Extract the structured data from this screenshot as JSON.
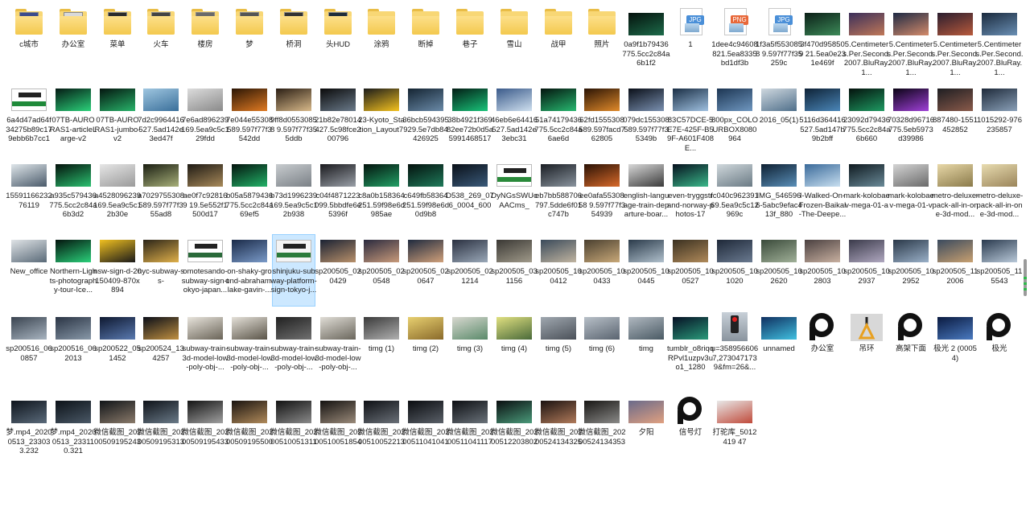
{
  "items": [
    {
      "label": "c城市",
      "kind": "folder",
      "doc": "#3c4b8c"
    },
    {
      "label": "办公室",
      "kind": "folder",
      "doc": "#d9d9d9"
    },
    {
      "label": "菜单",
      "kind": "folder",
      "doc": "#2b2b2b"
    },
    {
      "label": "火车",
      "kind": "folder",
      "doc": "#444444"
    },
    {
      "label": "楼房",
      "kind": "folder",
      "doc": "#6a6a6a"
    },
    {
      "label": "梦",
      "kind": "folder",
      "doc": "#555555"
    },
    {
      "label": "桥洞",
      "kind": "folder",
      "doc": "#333333"
    },
    {
      "label": "头HUD",
      "kind": "folder",
      "doc": "#1f2d3a"
    },
    {
      "label": "涂鸦",
      "kind": "folder"
    },
    {
      "label": "断掉",
      "kind": "folder"
    },
    {
      "label": "巷子",
      "kind": "folder"
    },
    {
      "label": "雪山",
      "kind": "folder"
    },
    {
      "label": "战甲",
      "kind": "folder"
    },
    {
      "label": "照片",
      "kind": "folder"
    },
    {
      "label": "0a9f1b79436775.5cc2c84a6b1f2",
      "kind": "image",
      "colors": [
        "#04110c",
        "#1d6b4a"
      ]
    },
    {
      "label": "1",
      "kind": "file",
      "badge": "JPG",
      "badgeColor": "#4a8fd8"
    },
    {
      "label": "1dee4c94608821.5ea8335bd1df3b",
      "kind": "file",
      "badge": "PNG",
      "badgeColor": "#e8683a"
    },
    {
      "label": "1f3a5f5530858 9.597f77f35259c",
      "kind": "file",
      "badge": "JPG",
      "badgeColor": "#4a8fd8"
    },
    {
      "label": "3f470d958509 21.5ea0e231e469f",
      "kind": "image",
      "colors": [
        "#0b1f17",
        "#3c8a58"
      ]
    },
    {
      "label": "5.Centimeters.Per.Second.2007.BluRay.1...",
      "kind": "image",
      "colors": [
        "#3b2f5a",
        "#c07858"
      ]
    },
    {
      "label": "5.Centimeters.Per.Second.2007.BluRay.1...",
      "kind": "image",
      "colors": [
        "#1e2a44",
        "#d48b6a"
      ]
    },
    {
      "label": "5.Centimeters.Per.Second.2007.BluRay.1...",
      "kind": "image",
      "colors": [
        "#2a1d2e",
        "#b85a3c"
      ]
    },
    {
      "label": "5.Centimeters.Per.Second.2007.BluRay.1...",
      "kind": "image",
      "colors": [
        "#1a2a3d",
        "#6a8fb4"
      ]
    },
    {
      "label": "6a4d47ad64f34275b89c179ebb6b7cc1",
      "kind": "sign",
      "colors": [
        "#ffffff",
        "#1f8a3a"
      ]
    },
    {
      "label": "07TB-AURORAS1-articleLarge-v2",
      "kind": "image",
      "colors": [
        "#051a14",
        "#2bd17a"
      ]
    },
    {
      "label": "07TB-AURORAS1-jumbo-v2",
      "kind": "image",
      "colors": [
        "#04150f",
        "#28b36a"
      ]
    },
    {
      "label": "7d2c9964416527.5ad142e3ed47f",
      "kind": "image",
      "colors": [
        "#9fc6e0",
        "#3a6f9a"
      ]
    },
    {
      "label": "7e6ad896239169.5ea9c5c129fdd",
      "kind": "image",
      "colors": [
        "#dcdcdc",
        "#8a8a8a"
      ]
    },
    {
      "label": "7e044e55308589.597f77f3542dd",
      "kind": "image",
      "colors": [
        "#2a1605",
        "#e07a22"
      ]
    },
    {
      "label": "9ff8d05530858 9.597f77f355ddb",
      "kind": "image",
      "colors": [
        "#2a1e14",
        "#d8b98a"
      ]
    },
    {
      "label": "21b82e78014427.5c98fce200796",
      "kind": "image",
      "colors": [
        "#0a0a0a",
        "#6a7a8a"
      ]
    },
    {
      "label": "23-Kyoto_Station_Layout7",
      "kind": "image",
      "colors": [
        "#1a1a1a",
        "#f4c21f"
      ]
    },
    {
      "label": "36bcb594395929.5e7db84426925",
      "kind": "image",
      "colors": [
        "#142432",
        "#6a8aa8"
      ]
    },
    {
      "label": "38b4921f36982ee72b0d5a5991468517",
      "kind": "image",
      "colors": [
        "#031c14",
        "#19c47a"
      ]
    },
    {
      "label": "46eb6e64416527.5ad142e3ebc31",
      "kind": "image",
      "colors": [
        "#3a5a8a",
        "#cfe0ef"
      ]
    },
    {
      "label": "51a74179436775.5cc2c84a6ae6d",
      "kind": "image",
      "colors": [
        "#04140e",
        "#27b870"
      ]
    },
    {
      "label": "62fd1555308589.597facd762805",
      "kind": "image",
      "colors": [
        "#2a1405",
        "#e08a2a"
      ]
    },
    {
      "label": "079dc155308589.597f77f35349b",
      "kind": "image",
      "colors": [
        "#0a0f18",
        "#7a90b0"
      ]
    },
    {
      "label": "83C57DCE-5E7E-425F-B59F-A601F408E...",
      "kind": "image",
      "colors": [
        "#1a2e44",
        "#9fc0e0"
      ]
    },
    {
      "label": "800px_COLOURBOX8080964",
      "kind": "image",
      "colors": [
        "#1c3552",
        "#6f97c0"
      ]
    },
    {
      "label": "2016_05(1)",
      "kind": "image",
      "colors": [
        "#cfd8df",
        "#4f6f8a"
      ]
    },
    {
      "label": "5116d364416527.5ad147b9b2bff",
      "kind": "image",
      "colors": [
        "#0e2236",
        "#4a86b8"
      ]
    },
    {
      "label": "23092d79436775.5cc2c84a6b660",
      "kind": "image",
      "colors": [
        "#04110c",
        "#1e9a62"
      ]
    },
    {
      "label": "70328d96716775.5eb5973d39986",
      "kind": "image",
      "colors": [
        "#0a0314",
        "#a040d8"
      ]
    },
    {
      "label": "887480-1551452852",
      "kind": "image",
      "colors": [
        "#1e1e22",
        "#8a5a4a"
      ]
    },
    {
      "label": "1015292-976235857",
      "kind": "image",
      "colors": [
        "#1e2a3a",
        "#8aa0b8"
      ]
    },
    {
      "label": "1559116623276119",
      "kind": "image",
      "colors": [
        "#dfe6ea",
        "#4a5a6a"
      ]
    },
    {
      "label": "a935c579436775.5cc2c84a6b3d2",
      "kind": "image",
      "colors": [
        "#04120c",
        "#2bc070"
      ]
    },
    {
      "label": "a4528096239169.5ea9c5c12b30e",
      "kind": "image",
      "colors": [
        "#e6e6e6",
        "#9a9a9a"
      ]
    },
    {
      "label": "a7029755308589.597f77f355ad8",
      "kind": "image",
      "colors": [
        "#1a1e12",
        "#a8b07a"
      ]
    },
    {
      "label": "ae0f7c928169 19.5e552f1500d17",
      "kind": "image",
      "colors": [
        "#1e1a14",
        "#a88a5a"
      ]
    },
    {
      "label": "b05a5879436775.5cc2c84a69ef5",
      "kind": "image",
      "colors": [
        "#04140e",
        "#22b268"
      ]
    },
    {
      "label": "b73d1996239169.5ea9c5c12b938",
      "kind": "image",
      "colors": [
        "#c8cccf",
        "#7a8086"
      ]
    },
    {
      "label": "c04f4871223099.5bbdfe6e5396f",
      "kind": "image",
      "colors": [
        "#1a1a1e",
        "#9aa0a8"
      ]
    },
    {
      "label": "c8a0b158364251.59f98e6d985ae",
      "kind": "image",
      "colors": [
        "#04140e",
        "#22a066"
      ]
    },
    {
      "label": "c649fb58364251.59f98e6d0d9b8",
      "kind": "image",
      "colors": [
        "#04120e",
        "#1f7a5a"
      ]
    },
    {
      "label": "D538_269_076_0004_600",
      "kind": "image",
      "colors": [
        "#0a1018",
        "#3a5a7a"
      ]
    },
    {
      "label": "DyNGsSWUcAACms_",
      "kind": "sign",
      "colors": [
        "#ffffff",
        "#2a8a3a"
      ]
    },
    {
      "label": "eb7bb588706797.5dde6f01c747b",
      "kind": "image",
      "colors": [
        "#1a1e24",
        "#8a949e"
      ]
    },
    {
      "label": "ee0afa5530858 9.597f77f354939",
      "kind": "image",
      "colors": [
        "#2a1205",
        "#d86a2a"
      ]
    },
    {
      "label": "english-language-train-departure-boar...",
      "kind": "image",
      "colors": [
        "#d8d8d8",
        "#3a3a3a"
      ]
    },
    {
      "label": "even-tryggstrand-norway-photos-17",
      "kind": "image",
      "colors": [
        "#06101e",
        "#3ab88a"
      ]
    },
    {
      "label": "fc040c962391 69.5ea9c5c12969c",
      "kind": "image",
      "colors": [
        "#d0d8dc",
        "#6a7a84"
      ]
    },
    {
      "label": "IMG_5465966-5abc9efac413f_880",
      "kind": "image",
      "colors": [
        "#0e2032",
        "#5a8fb8"
      ]
    },
    {
      "label": "I-Walked-On-Frozen-Baikal-The-Deepe...",
      "kind": "image",
      "colors": [
        "#3a6a9a",
        "#c8dff0"
      ]
    },
    {
      "label": "mark-kolobaev-mega-01-a",
      "kind": "image",
      "colors": [
        "#0f1a20",
        "#6a8a98"
      ]
    },
    {
      "label": "mark-kolobaev-mega-01-v",
      "kind": "image",
      "colors": [
        "#d4d4d4",
        "#6a6a6a"
      ]
    },
    {
      "label": "metro-deluxe-pack-all-in-one-3d-mod...",
      "kind": "image",
      "colors": [
        "#e8d8a8",
        "#8a7a4a"
      ]
    },
    {
      "label": "metro-deluxe-pack-all-in-one-3d-mod...",
      "kind": "image",
      "colors": [
        "#e8dcb0",
        "#9a845a"
      ]
    },
    {
      "label": "New_office",
      "kind": "image",
      "colors": [
        "#dfe3e6",
        "#5a6a78"
      ]
    },
    {
      "label": "Northern-Lights-photography-tour-Ice...",
      "kind": "image",
      "colors": [
        "#04140e",
        "#2ad07a"
      ]
    },
    {
      "label": "nsw-sign-d-20150409-870x894",
      "kind": "image",
      "colors": [
        "#f0c020",
        "#1a1a1a"
      ]
    },
    {
      "label": "nyc-subway-ss-",
      "kind": "image",
      "colors": [
        "#2a2418",
        "#e0b04a"
      ]
    },
    {
      "label": "omotesando-subway-sign-tokyo-japan...",
      "kind": "sign",
      "colors": [
        "#ffffff",
        "#2a6a3a"
      ]
    },
    {
      "label": "on-shaky-ground-abraham-lake-gavin-...",
      "kind": "image",
      "colors": [
        "#1a2a48",
        "#7a9ac8"
      ]
    },
    {
      "label": "shinjuku-subway-platform-sign-tokyo-j...",
      "kind": "sign",
      "colors": [
        "#f4f4f4",
        "#2a7a3a"
      ],
      "selected": true
    },
    {
      "label": "sp200505_020429",
      "kind": "image",
      "colors": [
        "#1a2233",
        "#b8906a"
      ]
    },
    {
      "label": "sp200505_020548",
      "kind": "image",
      "colors": [
        "#2a2a3e",
        "#c89a7a"
      ]
    },
    {
      "label": "sp200505_020647",
      "kind": "image",
      "colors": [
        "#1e2a3e",
        "#d0a07a"
      ]
    },
    {
      "label": "sp200505_021214",
      "kind": "image",
      "colors": [
        "#2a3040",
        "#9aa8b8"
      ]
    },
    {
      "label": "sp200505_031156",
      "kind": "image",
      "colors": [
        "#3a3834",
        "#a09a8a"
      ]
    },
    {
      "label": "sp200505_100412",
      "kind": "image",
      "colors": [
        "#3a4a5a",
        "#c0b4a0"
      ]
    },
    {
      "label": "sp200505_100433",
      "kind": "image",
      "colors": [
        "#4a4030",
        "#c8a878"
      ]
    },
    {
      "label": "sp200505_100445",
      "kind": "image",
      "colors": [
        "#2a3a4a",
        "#b0c0cc"
      ]
    },
    {
      "label": "sp200505_100527",
      "kind": "image",
      "colors": [
        "#3a3020",
        "#b08a5a"
      ]
    },
    {
      "label": "sp200505_101020",
      "kind": "image",
      "colors": [
        "#1e2838",
        "#6a7a90"
      ]
    },
    {
      "label": "sp200505_102620",
      "kind": "image",
      "colors": [
        "#3a4a3a",
        "#a0b098"
      ]
    },
    {
      "label": "sp200505_102803",
      "kind": "image",
      "colors": [
        "#4a4040",
        "#c8b0a0"
      ]
    },
    {
      "label": "sp200505_102937",
      "kind": "image",
      "colors": [
        "#3a3a4a",
        "#b0a8c0"
      ]
    },
    {
      "label": "sp200505_102952",
      "kind": "image",
      "colors": [
        "#2a3848",
        "#9ab0c8"
      ]
    },
    {
      "label": "sp200505_112006",
      "kind": "image",
      "colors": [
        "#3a4a5e",
        "#c8a070"
      ]
    },
    {
      "label": "sp200505_115543",
      "kind": "image",
      "colors": [
        "#2a3a4e",
        "#b8c8d8"
      ]
    },
    {
      "label": "sp200516_060857",
      "kind": "image",
      "colors": [
        "#3a4450",
        "#a8b4c0"
      ]
    },
    {
      "label": "sp200516_062013",
      "kind": "image",
      "colors": [
        "#2a3444",
        "#8898a8"
      ]
    },
    {
      "label": "sp200522_051452",
      "kind": "image",
      "colors": [
        "#0e1830",
        "#5a7ab0"
      ]
    },
    {
      "label": "sp200524_134257",
      "kind": "image",
      "colors": [
        "#0a0e18",
        "#c09040"
      ]
    },
    {
      "label": "subway-train-3d-model-low-poly-obj-...",
      "kind": "image",
      "colors": [
        "#e8e4dc",
        "#6a6458"
      ]
    },
    {
      "label": "subway-train-3d-model-low-poly-obj-...",
      "kind": "image",
      "colors": [
        "#e4e0d8",
        "#5a5448"
      ]
    },
    {
      "label": "subway-train-3d-model-low-poly-obj-...",
      "kind": "image",
      "colors": [
        "#202020",
        "#707070"
      ]
    },
    {
      "label": "subway-train-3d-model-low-poly-obj-...",
      "kind": "image",
      "colors": [
        "#e0ddd6",
        "#6a665c"
      ]
    },
    {
      "label": "timg (1)",
      "kind": "image",
      "colors": [
        "#3a3a3a",
        "#b0b0b0"
      ]
    },
    {
      "label": "timg (2)",
      "kind": "image",
      "colors": [
        "#e8d070",
        "#8a6a2a"
      ]
    },
    {
      "label": "timg (3)",
      "kind": "image",
      "colors": [
        "#d8d8d0",
        "#5a8a6a"
      ]
    },
    {
      "label": "timg (4)",
      "kind": "image",
      "colors": [
        "#e0e080",
        "#4a6a3a"
      ]
    },
    {
      "label": "timg (5)",
      "kind": "image",
      "colors": [
        "#a0a8b0",
        "#4a5058"
      ]
    },
    {
      "label": "timg (6)",
      "kind": "image",
      "colors": [
        "#b8c0c8",
        "#5a6470"
      ]
    },
    {
      "label": "timg",
      "kind": "image",
      "colors": [
        "#b0b8c0",
        "#4a5a64"
      ]
    },
    {
      "label": "tumblr_o8riqqRPvl1uzpv3uo1_1280",
      "kind": "image",
      "colors": [
        "#061024",
        "#2a9a7a"
      ]
    },
    {
      "label": "u=3589566067,2730471739&fm=26&...",
      "kind": "signal"
    },
    {
      "label": "unnamed",
      "kind": "image",
      "colors": [
        "#103060",
        "#40c0e0"
      ]
    },
    {
      "label": "办公室",
      "kind": "ring"
    },
    {
      "label": "吊环",
      "kind": "handle"
    },
    {
      "label": "高架下面",
      "kind": "ring"
    },
    {
      "label": "极光 2 (00054)",
      "kind": "image",
      "colors": [
        "#0a1a40",
        "#4a7ac0"
      ]
    },
    {
      "label": "极光",
      "kind": "ring"
    },
    {
      "label": "梦.mp4_20200513_233033.232",
      "kind": "image",
      "colors": [
        "#0e141c",
        "#5a6a7a"
      ]
    },
    {
      "label": "梦.mp4_20200513_233110.321",
      "kind": "image",
      "colors": [
        "#0c1218",
        "#4a5866"
      ]
    },
    {
      "label": "微信截图_20200509195243",
      "kind": "image",
      "colors": [
        "#101418",
        "#8a7a6a"
      ]
    },
    {
      "label": "微信截图_20200509195313",
      "kind": "image",
      "colors": [
        "#0e1218",
        "#6a7a88"
      ]
    },
    {
      "label": "微信截图_20200509195433",
      "kind": "image",
      "colors": [
        "#141414",
        "#a0a0a0"
      ]
    },
    {
      "label": "微信截图_20200509195500",
      "kind": "image",
      "colors": [
        "#1a1410",
        "#b08a5a"
      ]
    },
    {
      "label": "微信截图_20200510051311",
      "kind": "image",
      "colors": [
        "#121212",
        "#8a8a8a"
      ]
    },
    {
      "label": "微信截图_20200510051854",
      "kind": "image",
      "colors": [
        "#141210",
        "#9a8a7a"
      ]
    },
    {
      "label": "微信截图_20200510052213",
      "kind": "image",
      "colors": [
        "#0e1014",
        "#6a7078"
      ]
    },
    {
      "label": "微信截图_20200511041041",
      "kind": "image",
      "colors": [
        "#0a0c10",
        "#5a6068"
      ]
    },
    {
      "label": "微信截图_20200511041117",
      "kind": "image",
      "colors": [
        "#0c0e12",
        "#6a727a"
      ]
    },
    {
      "label": "微信截图_20200512203802",
      "kind": "image",
      "colors": [
        "#0a0e10",
        "#4a9a7a"
      ]
    },
    {
      "label": "微信截图_20200524134325",
      "kind": "image",
      "colors": [
        "#1a1210",
        "#b07a5a"
      ]
    },
    {
      "label": "微信截图_20200524134353",
      "kind": "image",
      "colors": [
        "#181614",
        "#8a8a88"
      ]
    },
    {
      "label": "夕阳",
      "kind": "image",
      "colors": [
        "#6a6a8a",
        "#e0a080"
      ]
    },
    {
      "label": "信号灯",
      "kind": "ring"
    },
    {
      "label": "打驼库_5012419 47",
      "kind": "image",
      "colors": [
        "#e8e8e8",
        "#c04a3a"
      ]
    }
  ],
  "rows": [
    23,
    23,
    23,
    23,
    23,
    17
  ]
}
